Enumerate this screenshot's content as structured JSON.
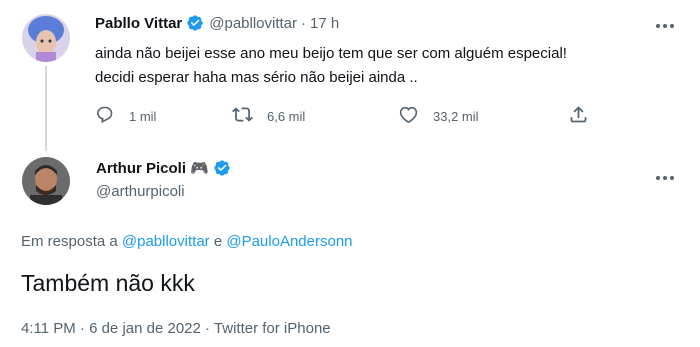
{
  "parent_tweet": {
    "display_name": "Pabllo Vittar",
    "handle": "@pabllovittar",
    "separator": "·",
    "time": "17 h",
    "text_line1": "ainda não beijei esse ano meu beijo tem que ser com alguém especial!",
    "text_line2": "decidi esperar haha mas sério não beijei ainda ..",
    "actions": {
      "reply_count": "1 mil",
      "retweet_count": "6,6 mil",
      "like_count": "33,2 mil"
    }
  },
  "reply_tweet": {
    "display_name": "Arthur Picoli 🎮",
    "handle": "@arthurpicoli",
    "in_reply_prefix": "Em resposta a ",
    "in_reply_user1": "@pabllovittar",
    "in_reply_and": " e ",
    "in_reply_user2": "@PauloAndersonn",
    "text": "Também não kkk",
    "timestamp": "4:11 PM · 6 de jan de 2022 · Twitter for iPhone"
  },
  "icons": {
    "verified": "verified-badge-icon",
    "more": "more-icon",
    "reply": "reply-icon",
    "retweet": "retweet-icon",
    "like": "like-icon",
    "share": "share-icon"
  },
  "colors": {
    "accent": "#1d9bf0",
    "secondary_text": "#536471",
    "primary_text": "#0f1419"
  }
}
